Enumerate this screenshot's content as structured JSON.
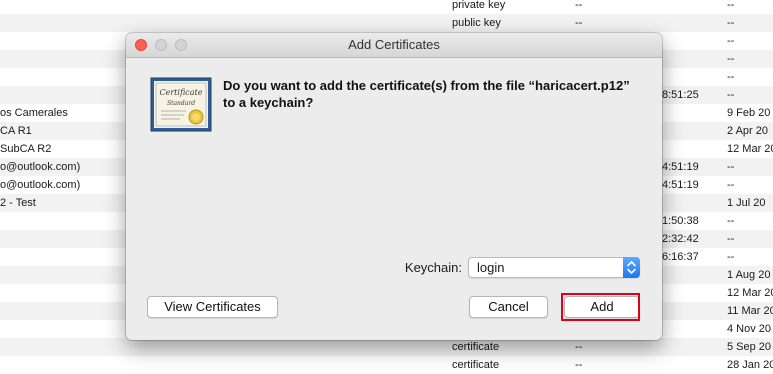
{
  "background": {
    "rows": [
      {
        "name": "",
        "kind": "private key",
        "modified": "--",
        "time": "",
        "expires": "--"
      },
      {
        "name": "",
        "kind": "public key",
        "modified": "--",
        "time": "",
        "expires": "--"
      },
      {
        "name": "",
        "kind": "",
        "modified": "",
        "time": "",
        "expires": "--"
      },
      {
        "name": "",
        "kind": "",
        "modified": "",
        "time": "",
        "expires": "--"
      },
      {
        "name": "",
        "kind": "",
        "modified": "",
        "time": "",
        "expires": "--"
      },
      {
        "name": "",
        "kind": "",
        "modified": "",
        "time": "8:51:25",
        "expires": "--"
      },
      {
        "name": "os Camerales",
        "kind": "",
        "modified": "",
        "time": "",
        "expires": "9 Feb 20"
      },
      {
        "name": "CA R1",
        "kind": "",
        "modified": "",
        "time": "",
        "expires": "2 Apr 20"
      },
      {
        "name": "SubCA R2",
        "kind": "",
        "modified": "",
        "time": "",
        "expires": "12 Mar 20"
      },
      {
        "name": "o@outlook.com)",
        "kind": "",
        "modified": "",
        "time": "4:51:19",
        "expires": "--"
      },
      {
        "name": "o@outlook.com)",
        "kind": "",
        "modified": "",
        "time": "4:51:19",
        "expires": "--"
      },
      {
        "name": "2 - Test",
        "kind": "",
        "modified": "",
        "time": "",
        "expires": "1 Jul 20"
      },
      {
        "name": "",
        "kind": "",
        "modified": "",
        "time": "1:50:38",
        "expires": "--"
      },
      {
        "name": "",
        "kind": "",
        "modified": "",
        "time": "2:32:42",
        "expires": "--"
      },
      {
        "name": "",
        "kind": "",
        "modified": "",
        "time": "6:16:37",
        "expires": "--"
      },
      {
        "name": "",
        "kind": "",
        "modified": "",
        "time": "",
        "expires": "1 Aug 20"
      },
      {
        "name": "",
        "kind": "",
        "modified": "",
        "time": "",
        "expires": "12 Mar 20"
      },
      {
        "name": "",
        "kind": "",
        "modified": "",
        "time": "",
        "expires": "11 Mar 20"
      },
      {
        "name": "",
        "kind": "",
        "modified": "",
        "time": "",
        "expires": "4 Nov 20"
      },
      {
        "name": "",
        "kind": "certificate",
        "modified": "--",
        "time": "",
        "expires": "5 Sep 20"
      },
      {
        "name": "",
        "kind": "certificate",
        "modified": "--",
        "time": "",
        "expires": "28 Jan 20"
      }
    ]
  },
  "dialog": {
    "title": "Add Certificates",
    "question": "Do you want to add the certificate(s) from the file “haricacert.p12” to a keychain?",
    "icon": {
      "name": "certificate-icon",
      "script_line1": "Certificate",
      "script_line2": "Standard",
      "seal_color": "#e8c53a"
    },
    "keychain_label": "Keychain:",
    "keychain_value": "login",
    "view_certificates_label": "View Certificates",
    "cancel_label": "Cancel",
    "add_label": "Add",
    "highlight_color": "#e0001b",
    "accent_color": "#1f77f2"
  }
}
